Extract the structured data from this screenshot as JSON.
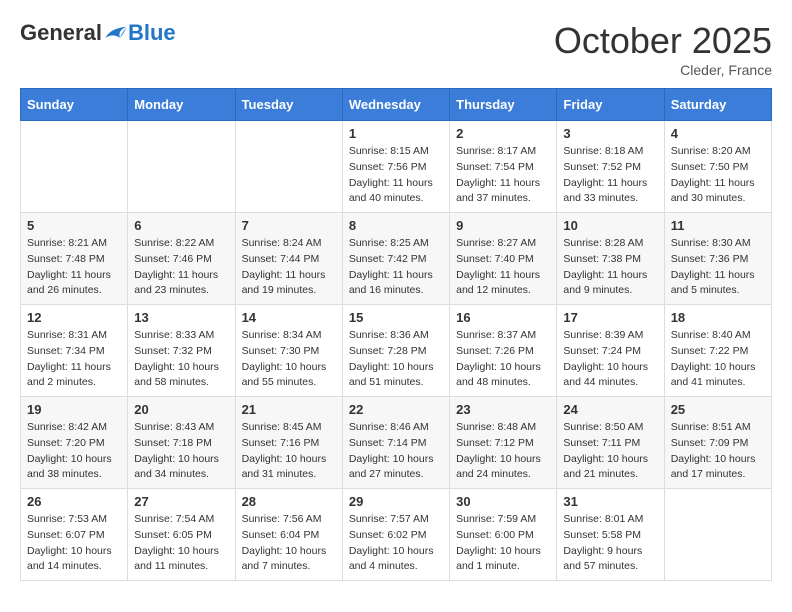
{
  "logo": {
    "general": "General",
    "blue": "Blue"
  },
  "title": "October 2025",
  "subtitle": "Cleder, France",
  "days_of_week": [
    "Sunday",
    "Monday",
    "Tuesday",
    "Wednesday",
    "Thursday",
    "Friday",
    "Saturday"
  ],
  "weeks": [
    [
      {
        "day": "",
        "info": ""
      },
      {
        "day": "",
        "info": ""
      },
      {
        "day": "",
        "info": ""
      },
      {
        "day": "1",
        "info": "Sunrise: 8:15 AM\nSunset: 7:56 PM\nDaylight: 11 hours and 40 minutes."
      },
      {
        "day": "2",
        "info": "Sunrise: 8:17 AM\nSunset: 7:54 PM\nDaylight: 11 hours and 37 minutes."
      },
      {
        "day": "3",
        "info": "Sunrise: 8:18 AM\nSunset: 7:52 PM\nDaylight: 11 hours and 33 minutes."
      },
      {
        "day": "4",
        "info": "Sunrise: 8:20 AM\nSunset: 7:50 PM\nDaylight: 11 hours and 30 minutes."
      }
    ],
    [
      {
        "day": "5",
        "info": "Sunrise: 8:21 AM\nSunset: 7:48 PM\nDaylight: 11 hours and 26 minutes."
      },
      {
        "day": "6",
        "info": "Sunrise: 8:22 AM\nSunset: 7:46 PM\nDaylight: 11 hours and 23 minutes."
      },
      {
        "day": "7",
        "info": "Sunrise: 8:24 AM\nSunset: 7:44 PM\nDaylight: 11 hours and 19 minutes."
      },
      {
        "day": "8",
        "info": "Sunrise: 8:25 AM\nSunset: 7:42 PM\nDaylight: 11 hours and 16 minutes."
      },
      {
        "day": "9",
        "info": "Sunrise: 8:27 AM\nSunset: 7:40 PM\nDaylight: 11 hours and 12 minutes."
      },
      {
        "day": "10",
        "info": "Sunrise: 8:28 AM\nSunset: 7:38 PM\nDaylight: 11 hours and 9 minutes."
      },
      {
        "day": "11",
        "info": "Sunrise: 8:30 AM\nSunset: 7:36 PM\nDaylight: 11 hours and 5 minutes."
      }
    ],
    [
      {
        "day": "12",
        "info": "Sunrise: 8:31 AM\nSunset: 7:34 PM\nDaylight: 11 hours and 2 minutes."
      },
      {
        "day": "13",
        "info": "Sunrise: 8:33 AM\nSunset: 7:32 PM\nDaylight: 10 hours and 58 minutes."
      },
      {
        "day": "14",
        "info": "Sunrise: 8:34 AM\nSunset: 7:30 PM\nDaylight: 10 hours and 55 minutes."
      },
      {
        "day": "15",
        "info": "Sunrise: 8:36 AM\nSunset: 7:28 PM\nDaylight: 10 hours and 51 minutes."
      },
      {
        "day": "16",
        "info": "Sunrise: 8:37 AM\nSunset: 7:26 PM\nDaylight: 10 hours and 48 minutes."
      },
      {
        "day": "17",
        "info": "Sunrise: 8:39 AM\nSunset: 7:24 PM\nDaylight: 10 hours and 44 minutes."
      },
      {
        "day": "18",
        "info": "Sunrise: 8:40 AM\nSunset: 7:22 PM\nDaylight: 10 hours and 41 minutes."
      }
    ],
    [
      {
        "day": "19",
        "info": "Sunrise: 8:42 AM\nSunset: 7:20 PM\nDaylight: 10 hours and 38 minutes."
      },
      {
        "day": "20",
        "info": "Sunrise: 8:43 AM\nSunset: 7:18 PM\nDaylight: 10 hours and 34 minutes."
      },
      {
        "day": "21",
        "info": "Sunrise: 8:45 AM\nSunset: 7:16 PM\nDaylight: 10 hours and 31 minutes."
      },
      {
        "day": "22",
        "info": "Sunrise: 8:46 AM\nSunset: 7:14 PM\nDaylight: 10 hours and 27 minutes."
      },
      {
        "day": "23",
        "info": "Sunrise: 8:48 AM\nSunset: 7:12 PM\nDaylight: 10 hours and 24 minutes."
      },
      {
        "day": "24",
        "info": "Sunrise: 8:50 AM\nSunset: 7:11 PM\nDaylight: 10 hours and 21 minutes."
      },
      {
        "day": "25",
        "info": "Sunrise: 8:51 AM\nSunset: 7:09 PM\nDaylight: 10 hours and 17 minutes."
      }
    ],
    [
      {
        "day": "26",
        "info": "Sunrise: 7:53 AM\nSunset: 6:07 PM\nDaylight: 10 hours and 14 minutes."
      },
      {
        "day": "27",
        "info": "Sunrise: 7:54 AM\nSunset: 6:05 PM\nDaylight: 10 hours and 11 minutes."
      },
      {
        "day": "28",
        "info": "Sunrise: 7:56 AM\nSunset: 6:04 PM\nDaylight: 10 hours and 7 minutes."
      },
      {
        "day": "29",
        "info": "Sunrise: 7:57 AM\nSunset: 6:02 PM\nDaylight: 10 hours and 4 minutes."
      },
      {
        "day": "30",
        "info": "Sunrise: 7:59 AM\nSunset: 6:00 PM\nDaylight: 10 hours and 1 minute."
      },
      {
        "day": "31",
        "info": "Sunrise: 8:01 AM\nSunset: 5:58 PM\nDaylight: 9 hours and 57 minutes."
      },
      {
        "day": "",
        "info": ""
      }
    ]
  ]
}
